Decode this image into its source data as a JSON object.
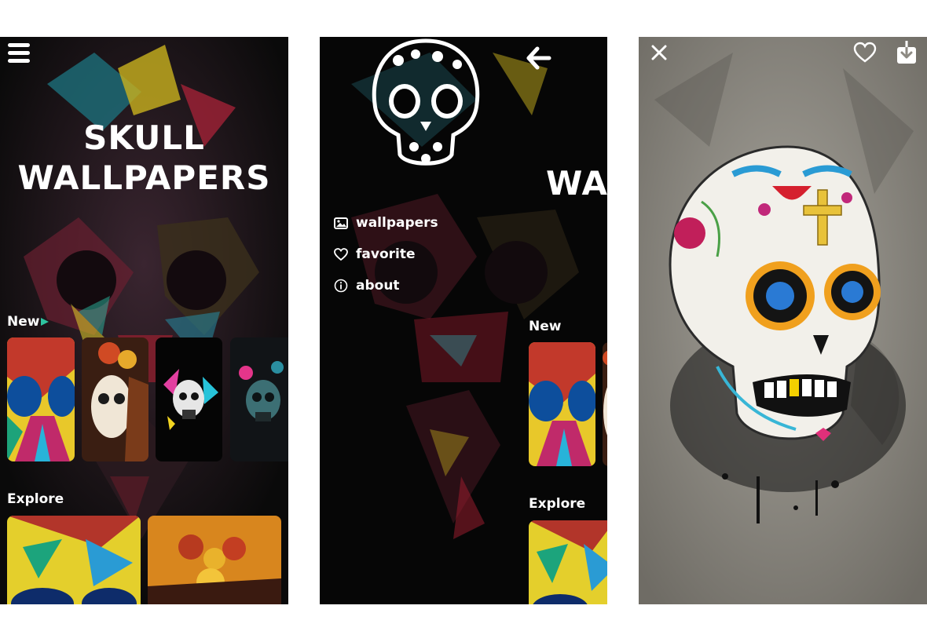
{
  "screen1": {
    "title_line1": "SKULL",
    "title_line2": "WALLPAPERS",
    "new_label": "New",
    "explore_label": "Explore",
    "icons": {
      "menu": "hamburger-menu-icon",
      "new_arrow": "triangle-arrow-icon"
    }
  },
  "screen2": {
    "title_fragment": "WA",
    "menu": [
      {
        "label": "wallpapers",
        "icon": "image-gallery-icon"
      },
      {
        "label": "favorite",
        "icon": "heart-outline-icon"
      },
      {
        "label": "about",
        "icon": "info-circle-icon"
      }
    ],
    "new_label": "New",
    "explore_label": "Explore",
    "icons": {
      "back": "back-arrow-icon",
      "logo": "floral-skull-logo"
    }
  },
  "screen3": {
    "icons": {
      "close": "close-icon",
      "favorite": "heart-outline-icon",
      "download": "download-icon"
    }
  },
  "colors": {
    "background": "#ffffff",
    "app_bg": "#0a0a0a",
    "text": "#ffffff",
    "accent_green": "#2ec4a0"
  }
}
